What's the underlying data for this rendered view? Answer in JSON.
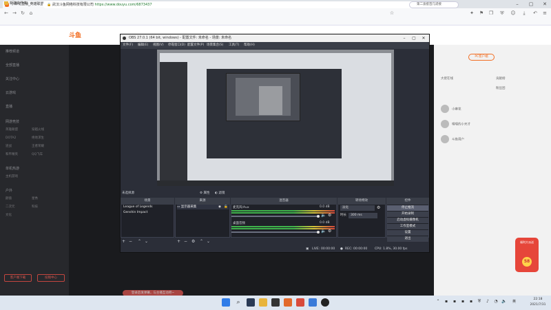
{
  "browser": {
    "tab_title": "小麻花直播_英雄联盟直播_斗鱼直播",
    "url_host": "武汉斗鱼网络科技有限公司",
    "url": "https://www.douyu.com/6873437",
    "search_text": "第二波疫苗几适接",
    "bookmark_folder": "新建文件夹"
  },
  "obs": {
    "title": "OBS 27.0.1 (64 bit, windows) - 配置文件: 未命名 - 场景: 未命名",
    "menu": [
      "文件(F)",
      "编辑(E)",
      "视图(V)",
      "停靠窗口(D)",
      "配置文件(P)",
      "场景集合(S)",
      "工具(T)",
      "帮助(H)"
    ],
    "preview_label": "未选择源",
    "prop_label": "属性",
    "filter_label": "滤镜",
    "docks": {
      "scenes_header": "场景",
      "sources_header": "来源",
      "mixer_header": "混音器",
      "transitions_header": "转场特效",
      "controls_header": "控件"
    },
    "scenes": [
      "League of Legends",
      "Genshin Impact"
    ],
    "sources": [
      "显示器采集"
    ],
    "mixer": [
      {
        "name": "麦克风/Aux",
        "db": "0.0 dB"
      },
      {
        "name": "桌面音频",
        "db": "0.0 dB"
      }
    ],
    "transition": {
      "value": "淡化",
      "duration_label": "时长",
      "duration": "300 ms"
    },
    "controls": [
      "停止推流",
      "开始录制",
      "启动虚拟摄像机",
      "工作室模式",
      "设置",
      "退出"
    ],
    "status": {
      "live_label": "LIVE:",
      "live_time": "00:00:00",
      "rec_label": "REC:",
      "rec_time": "00:00:00",
      "cpu": "CPU: 1.8%, 30.00 fps"
    }
  },
  "douyu": {
    "logo": "斗鱼",
    "sidebar": [
      "推荐频道",
      "全部直播",
      "关注中心",
      "云游戏",
      "直播",
      "网游竞技",
      "英雄联盟",
      "穿越火线",
      "DOTA2",
      "绝地求生",
      "逆战",
      "王者荣耀",
      "和平精英",
      "QQ飞车",
      "单机热游",
      "主机游戏",
      "户外",
      "颜值",
      "星秀",
      "二次元",
      "科技",
      "文化"
    ],
    "sidebar_buttons": [
      "客户端下载",
      "投稿中心"
    ],
    "right_tag": "PC客户端",
    "right_rows": [
      "大佬在线",
      "贡献榜",
      "粉丝团",
      "小麻花",
      "嘿嘿的小天才",
      "斗鱼用户"
    ],
    "promo_title": "福利大派送",
    "promo_coin": "58",
    "chat_pill": "登录后发弹幕，与主播互动吧~"
  },
  "taskbar": {
    "tray_text": "英",
    "time": "22:18",
    "date": "2021/7/31"
  }
}
